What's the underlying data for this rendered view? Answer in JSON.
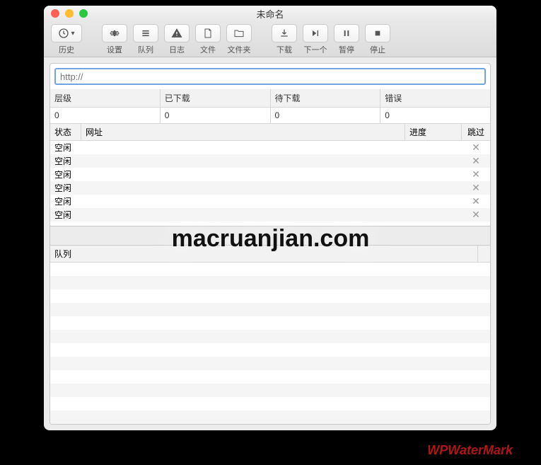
{
  "window": {
    "title": "未命名"
  },
  "toolbar": {
    "history": "历史",
    "settings": "设置",
    "queue": "队列",
    "log": "日志",
    "file": "文件",
    "folder": "文件夹",
    "download": "下载",
    "next": "下一个",
    "pause": "暂停",
    "stop": "停止"
  },
  "url_placeholder": "http://",
  "stats": {
    "headers": {
      "level": "层级",
      "downloaded": "已下载",
      "pending": "待下载",
      "errors": "错误"
    },
    "values": {
      "level": "0",
      "downloaded": "0",
      "pending": "0",
      "errors": "0"
    }
  },
  "task_headers": {
    "status": "状态",
    "url": "网址",
    "progress": "进度",
    "skip": "跳过"
  },
  "tasks": [
    {
      "status": "空闲"
    },
    {
      "status": "空闲"
    },
    {
      "status": "空闲"
    },
    {
      "status": "空闲"
    },
    {
      "status": "空闲"
    },
    {
      "status": "空闲"
    }
  ],
  "skip_glyph": "✕",
  "queue_header": "队列",
  "watermarks": {
    "center": "macruanjian.com",
    "bottom": "WPWaterMark"
  }
}
